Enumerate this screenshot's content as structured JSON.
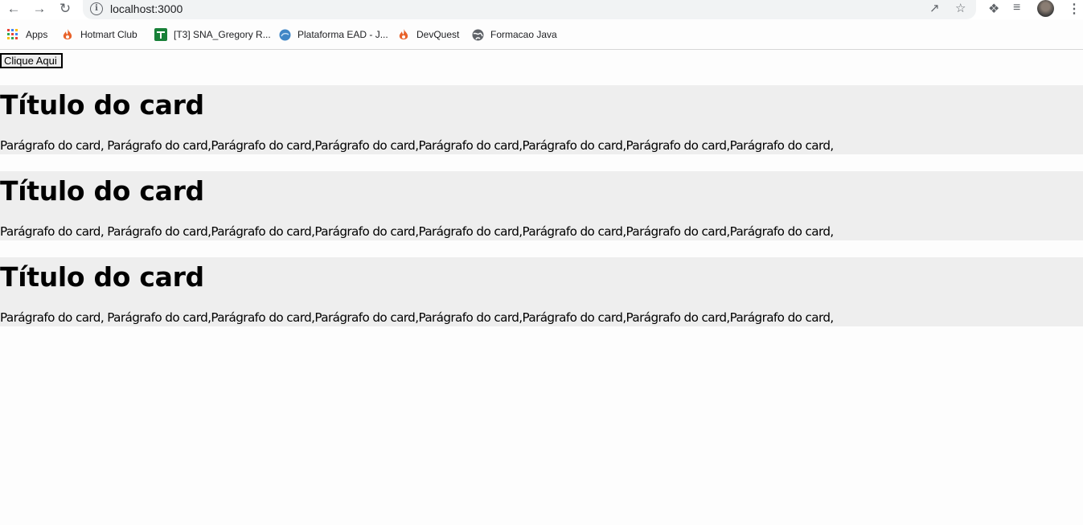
{
  "browser": {
    "url": "localhost:3000",
    "icons": {
      "back": "arrow-left-icon",
      "forward": "arrow-right-icon",
      "reload": "reload-icon",
      "info": "info-icon",
      "share": "share-icon",
      "bookmark": "star-icon",
      "extensions": "puzzle-icon",
      "reading_list": "reading-list-icon",
      "menu": "kebab-menu-icon"
    }
  },
  "bookmarks": [
    {
      "label": "Apps",
      "icon": "apps-grid-icon"
    },
    {
      "label": "Hotmart Club",
      "icon": "flame-icon"
    },
    {
      "label": "[T3] SNA_Gregory R...",
      "icon": "sheets-icon"
    },
    {
      "label": "Plataforma EAD - J...",
      "icon": "globe-blue-icon"
    },
    {
      "label": "DevQuest",
      "icon": "flame-icon"
    },
    {
      "label": "Formacao Java",
      "icon": "globe-icon"
    }
  ],
  "page": {
    "button_label": "Clique Aqui",
    "cards": [
      {
        "title": "Título do card",
        "text": "Parágrafo do card, Parágrafo do card,Parágrafo do card,Parágrafo do card,Parágrafo do card,Parágrafo do card,Parágrafo do card,Parágrafo do card,"
      },
      {
        "title": "Título do card",
        "text": "Parágrafo do card, Parágrafo do card,Parágrafo do card,Parágrafo do card,Parágrafo do card,Parágrafo do card,Parágrafo do card,Parágrafo do card,"
      },
      {
        "title": "Título do card",
        "text": "Parágrafo do card, Parágrafo do card,Parágrafo do card,Parágrafo do card,Parágrafo do card,Parágrafo do card,Parágrafo do card,Parágrafo do card,"
      }
    ],
    "colors": {
      "card_background": "#eeeeee",
      "page_background": "#fdfdfd"
    }
  }
}
